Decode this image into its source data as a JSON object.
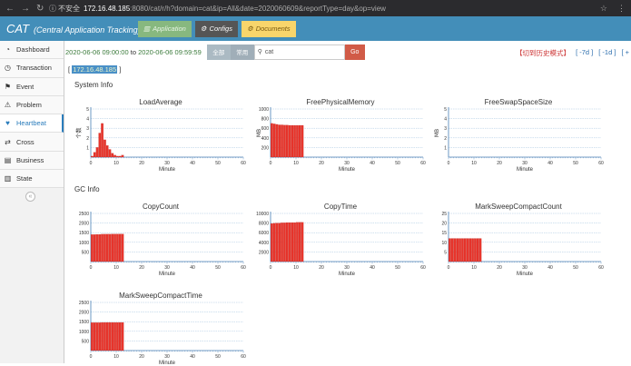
{
  "browser": {
    "security": "不安全",
    "host": "172.16.48.185",
    "path": ":8080/cat/r/h?domain=cat&ip=All&date=2020060609&reportType=day&op=view"
  },
  "header": {
    "brand": "CAT",
    "brand_sub": "(Central Application Tracking)",
    "buttons": {
      "application": "Application",
      "configs": "Configs",
      "documents": "Documents"
    }
  },
  "sidebar": {
    "items": [
      {
        "label": "Dashboard",
        "icon": "dashboard-icon"
      },
      {
        "label": "Transaction",
        "icon": "clock-icon"
      },
      {
        "label": "Event",
        "icon": "flag-icon"
      },
      {
        "label": "Problem",
        "icon": "alert-icon"
      },
      {
        "label": "Heartbeat",
        "icon": "heart-icon"
      },
      {
        "label": "Cross",
        "icon": "shuffle-icon"
      },
      {
        "label": "Business",
        "icon": "table-icon"
      },
      {
        "label": "State",
        "icon": "bar-chart-icon"
      }
    ],
    "active": "Heartbeat",
    "collapse_glyph": "«"
  },
  "toolbar": {
    "start": "2020-06-06 09:00:00",
    "to": "to",
    "end": "2020-06-06 09:59:59",
    "tab_all": "全部",
    "tab_common": "常用",
    "search_value": "cat",
    "go": "Go",
    "history": "【切到历史模式】",
    "minus7": "[ -7d ]",
    "minus1": "[ -1d ]",
    "plus": "[ +"
  },
  "ip": {
    "open": "[",
    "value": "172.16.48.185",
    "close": "]"
  },
  "sections": {
    "system": "System Info",
    "gc": "GC Info"
  },
  "colors": {
    "bar": "#e8352c",
    "accent": "#438eb9"
  },
  "chart_data": [
    {
      "type": "bar",
      "title": "LoadAverage",
      "xlabel": "Minute",
      "ylabel": "个数",
      "xlim": [
        0,
        60
      ],
      "ylim": [
        0,
        5
      ],
      "yticks": [
        1,
        2,
        3,
        4,
        5
      ],
      "xticks": [
        0,
        10,
        20,
        30,
        40,
        50,
        60
      ],
      "x": [
        0,
        1,
        2,
        3,
        4,
        5,
        6,
        7,
        8,
        9,
        10,
        11,
        12
      ],
      "values": [
        0.1,
        0.5,
        1.0,
        2.5,
        3.5,
        1.8,
        1.2,
        0.8,
        0.4,
        0.2,
        0.1,
        0.1,
        0.2
      ]
    },
    {
      "type": "bar",
      "title": "FreePhysicalMemory",
      "xlabel": "Minute",
      "ylabel": "MB",
      "xlim": [
        0,
        60
      ],
      "ylim": [
        0,
        1000
      ],
      "yticks": [
        200,
        400,
        600,
        800,
        1000
      ],
      "xticks": [
        0,
        10,
        20,
        30,
        40,
        50,
        60
      ],
      "x": [
        0,
        1,
        2,
        3,
        4,
        5,
        6,
        7,
        8,
        9,
        10,
        11,
        12
      ],
      "values": [
        700,
        690,
        680,
        670,
        670,
        665,
        665,
        660,
        660,
        660,
        660,
        660,
        660
      ]
    },
    {
      "type": "bar",
      "title": "FreeSwapSpaceSize",
      "xlabel": "Minute",
      "ylabel": "MB",
      "xlim": [
        0,
        60
      ],
      "ylim": [
        0,
        5
      ],
      "yticks": [
        1,
        2,
        3,
        4,
        5
      ],
      "xticks": [
        0,
        10,
        20,
        30,
        40,
        50,
        60
      ],
      "x": [],
      "values": []
    },
    {
      "type": "bar",
      "title": "CopyCount",
      "xlabel": "Minute",
      "ylabel": "",
      "xlim": [
        0,
        60
      ],
      "ylim": [
        0,
        2500
      ],
      "yticks": [
        500,
        1000,
        1500,
        2000,
        2500
      ],
      "xticks": [
        0,
        10,
        20,
        30,
        40,
        50,
        60
      ],
      "x": [
        0,
        1,
        2,
        3,
        4,
        5,
        6,
        7,
        8,
        9,
        10,
        11,
        12
      ],
      "values": [
        1400,
        1400,
        1410,
        1410,
        1420,
        1420,
        1420,
        1420,
        1430,
        1430,
        1430,
        1430,
        1430
      ]
    },
    {
      "type": "bar",
      "title": "CopyTime",
      "xlabel": "Minute",
      "ylabel": "",
      "xlim": [
        0,
        60
      ],
      "ylim": [
        0,
        10000
      ],
      "yticks": [
        2000,
        4000,
        6000,
        8000,
        10000
      ],
      "xticks": [
        0,
        10,
        20,
        30,
        40,
        50,
        60
      ],
      "x": [
        0,
        1,
        2,
        3,
        4,
        5,
        6,
        7,
        8,
        9,
        10,
        11,
        12
      ],
      "values": [
        7900,
        7950,
        8000,
        8000,
        8050,
        8050,
        8100,
        8100,
        8100,
        8100,
        8150,
        8150,
        8150
      ]
    },
    {
      "type": "bar",
      "title": "MarkSweepCompactCount",
      "xlabel": "Minute",
      "ylabel": "",
      "xlim": [
        0,
        60
      ],
      "ylim": [
        0,
        25
      ],
      "yticks": [
        5,
        10,
        15,
        20,
        25
      ],
      "xticks": [
        0,
        10,
        20,
        30,
        40,
        50,
        60
      ],
      "x": [
        0,
        1,
        2,
        3,
        4,
        5,
        6,
        7,
        8,
        9,
        10,
        11,
        12
      ],
      "values": [
        12,
        12,
        12,
        12,
        12,
        12,
        12,
        12,
        12,
        12,
        12,
        12,
        12
      ]
    },
    {
      "type": "bar",
      "title": "MarkSweepCompactTime",
      "xlabel": "Minute",
      "ylabel": "",
      "xlim": [
        0,
        60
      ],
      "ylim": [
        0,
        2500
      ],
      "yticks": [
        500,
        1000,
        1500,
        2000,
        2500
      ],
      "xticks": [
        0,
        10,
        20,
        30,
        40,
        50,
        60
      ],
      "x": [
        0,
        1,
        2,
        3,
        4,
        5,
        6,
        7,
        8,
        9,
        10,
        11,
        12
      ],
      "values": [
        1450,
        1450,
        1450,
        1450,
        1460,
        1460,
        1460,
        1460,
        1460,
        1460,
        1460,
        1460,
        1460
      ]
    }
  ]
}
